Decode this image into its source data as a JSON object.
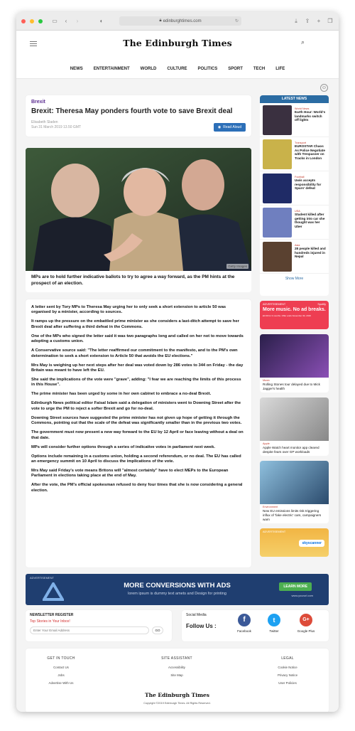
{
  "browser": {
    "url": "edinburghtimes.com",
    "traffic_colors": [
      "#ff5f57",
      "#ffbd2e",
      "#28c840"
    ]
  },
  "site": {
    "logo": "The Edinburgh Times",
    "nav": [
      "NEWS",
      "ENTERTAINMENT",
      "WORLD",
      "CULTURE",
      "POLITICS",
      "SPORT",
      "TECH",
      "LIFE"
    ]
  },
  "article": {
    "category": "Brexit",
    "title": "Brexit: Theresa May ponders fourth vote to save Brexit deal",
    "author": "Elisabeth Sladen",
    "date": "Sun 31 March 2019 13.50 GMT",
    "read_aloud": "Read Aloud",
    "photo_credit": "Getty Images",
    "caption": "MPs are to hold further indicative ballots to try to agree a way forward, as the PM hints at the prospect of an election.",
    "paragraphs": [
      "A letter sent by Tory MPs to Theresa May urging her to only seek a short extension to article 50 was organised by a minister, according to sources.",
      "It ramps up the pressure on the embattled prime minister as she considers a last-ditch attempt to save her Brexit deal after suffering a third defeat in the Commons.",
      "One of the MPs who signed the letter said it was two paragraphs long and called on her not to move towards adopting a customs union.",
      "A Conservative source said: \"The letter reaffirmed our commitment to the manifesto, and to the PM's own determination to seek a short extension to Article 50 that avoids the EU elections.\"",
      "Mrs May is weighing up her next steps after her deal was voted down by 286 votes to 344 on Friday - the day Britain was meant to have left the EU.",
      "She said the implications of the vote were \"grave\", adding: \"I fear we are reaching the limits of this process in this House\".",
      "The prime minister has been urged by some in her own cabinet to embrace a no-deal Brexit.",
      "Edinburgh News political editor Faisal Islam said a delegation of ministers went to Downing Street after the vote to urge the PM to reject a softer Brexit and go for no-deal.",
      "Downing Street sources have suggested the prime minister has not given up hope of getting it through the Commons, pointing out that the scale of the defeat was significantly smaller than in the previous two votes.",
      "The government must now present a new way forward to the EU by 12 April or face leaving without a deal on that date.",
      "MPs will consider further options through a series of indicative votes in parliament next week.",
      "Options include remaining in a customs union, holding a second referendum, or no deal. The EU has called an emergency summit on 10 April to discuss the implications of the vote.",
      "Mrs May said Friday's vote means Britons will \"almost certainly\" have to elect MEPs to the European Parliament in elections taking place at the end of May.",
      "After the vote, the PM's official spokesman refused to deny four times that she is now considering a general election."
    ]
  },
  "latest": {
    "heading": "LATEST NEWS",
    "items": [
      {
        "category": "World News",
        "title": "Earth Hour: World's landmarks switch off lights",
        "color": "#3a3040"
      },
      {
        "category": "Transport",
        "title": "EUROSTAR Chaos As Police Negotiate with Trespasser on Tracks in London",
        "color": "#c9b24a"
      },
      {
        "category": "Football",
        "title": "Uwis accepts responsibility for Spurs' defeat",
        "color": "#1f2b66"
      },
      {
        "category": "USA",
        "title": "Student killed after getting into car she thought was her Uber",
        "color": "#6f7fbf"
      },
      {
        "category": "Asia",
        "title": "28 people killed and hundreds injured in Nepal",
        "color": "#5a4130"
      }
    ],
    "show_more": "Show More"
  },
  "spotify_ad": {
    "label": "ADVERTISEMENT",
    "brand": "Spotify",
    "headline": "More music. No ad breaks.",
    "fine": "£0.99 for 3 months. Offer ends November 30, 2019"
  },
  "side_stories": [
    {
      "category": "Music",
      "title": "Rolling Stones tour delayed due to Mick Jagger's health"
    },
    {
      "category": "Apple",
      "title": "Apple Watch heart monitor app cleared despite fears over GP workloads"
    },
    {
      "category": "Environment",
      "title": "New EU emissions limits risk triggering influx of 'fake electric' cars, campaigners warn"
    }
  ],
  "skyscanner_ad": {
    "label": "ADVERTISEMENT",
    "brand": "skyscanner"
  },
  "banner_ad": {
    "label": "ADVERTISEMENT",
    "headline": "MORE CONVERSIONS WITH ADS",
    "sub": "lorem ipsum is dummy text amets and Design for printing",
    "cta": "LEARN MORE",
    "url": "www.yoururl.com"
  },
  "newsletter": {
    "heading": "NEWSLETTER REGISTER",
    "sub": "Top Stories in Your Inbox!",
    "placeholder": "Enter Your Email Address",
    "go": "GO"
  },
  "social": {
    "heading": "Social Media",
    "follow": "Follow Us :",
    "facebook": "Facebook",
    "twitter": "Twitter",
    "google": "Google Plus",
    "fb_color": "#3b5998",
    "tw_color": "#1da1f2",
    "gp_color": "#dd4b39"
  },
  "footer": {
    "col1_heading": "GET IN TOUCH",
    "col1": [
      "Contact Us",
      "Jobs",
      "Advertise With Us"
    ],
    "col2_heading": "SITE ASSISTANT",
    "col2": [
      "Accessibility",
      "Site Map"
    ],
    "col3_heading": "LEGAL",
    "col3": [
      "Cookie Notice",
      "Privacy Notice",
      "User Policies"
    ],
    "logo": "The Edinburgh Times",
    "copyright": "Copyright ©2019 Edinburgh Times. All Rights Reserved."
  }
}
